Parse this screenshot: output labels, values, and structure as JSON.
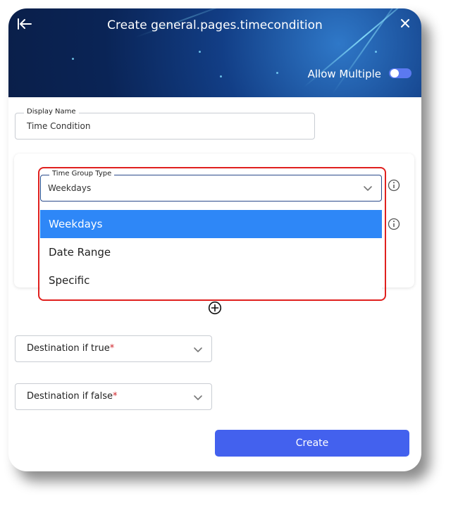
{
  "header": {
    "title": "Create general.pages.timecondition",
    "back_icon": "back-arrow-icon",
    "close_icon": "close-icon",
    "allow_multiple_label": "Allow Multiple",
    "allow_multiple_on": false
  },
  "display_name": {
    "legend": "Display Name",
    "value": "Time Condition"
  },
  "time_group": {
    "legend": "Time Group Type",
    "value": "Weekdays",
    "options": [
      "Weekdays",
      "Date Range",
      "Specific"
    ],
    "selected_index": 0
  },
  "destinations": {
    "true_label": "Destination if true",
    "false_label": "Destination if false",
    "required_mark": "*"
  },
  "actions": {
    "create_label": "Create"
  },
  "colors": {
    "accent": "#4361ee",
    "selected_option": "#2e87f7",
    "highlight": "#e0201e",
    "required": "#d0242a"
  }
}
